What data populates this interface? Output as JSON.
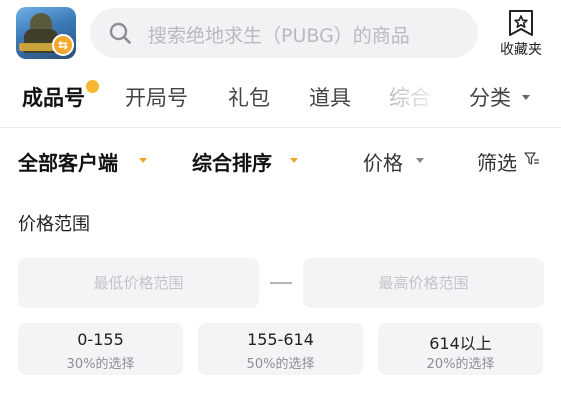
{
  "header": {
    "app_icon": "pubg-game-icon",
    "swap_badge": "⇆",
    "search_placeholder": "搜索绝地求生（PUBG）的商品",
    "favorite_label": "收藏夹"
  },
  "tabs": [
    {
      "label": "成品号",
      "active": true
    },
    {
      "label": "开局号",
      "active": false
    },
    {
      "label": "礼包",
      "active": false
    },
    {
      "label": "道具",
      "active": false
    },
    {
      "label": "综合",
      "active": false
    },
    {
      "label": "分类",
      "active": false
    }
  ],
  "filters": {
    "client": "全部客户端",
    "sort": "综合排序",
    "price": "价格",
    "screen": "筛选"
  },
  "price_range": {
    "title": "价格范围",
    "min_placeholder": "最低价格范围",
    "max_placeholder": "最高价格范围",
    "separator": "—",
    "presets": [
      {
        "range": "0-155",
        "share": "30%的选择"
      },
      {
        "range": "155-614",
        "share": "50%的选择"
      },
      {
        "range": "614以上",
        "share": "20%的选择"
      }
    ]
  },
  "colors": {
    "accent": "#f7b731",
    "caret_orange": "#f0a22a",
    "input_bg": "#f4f4f6"
  }
}
